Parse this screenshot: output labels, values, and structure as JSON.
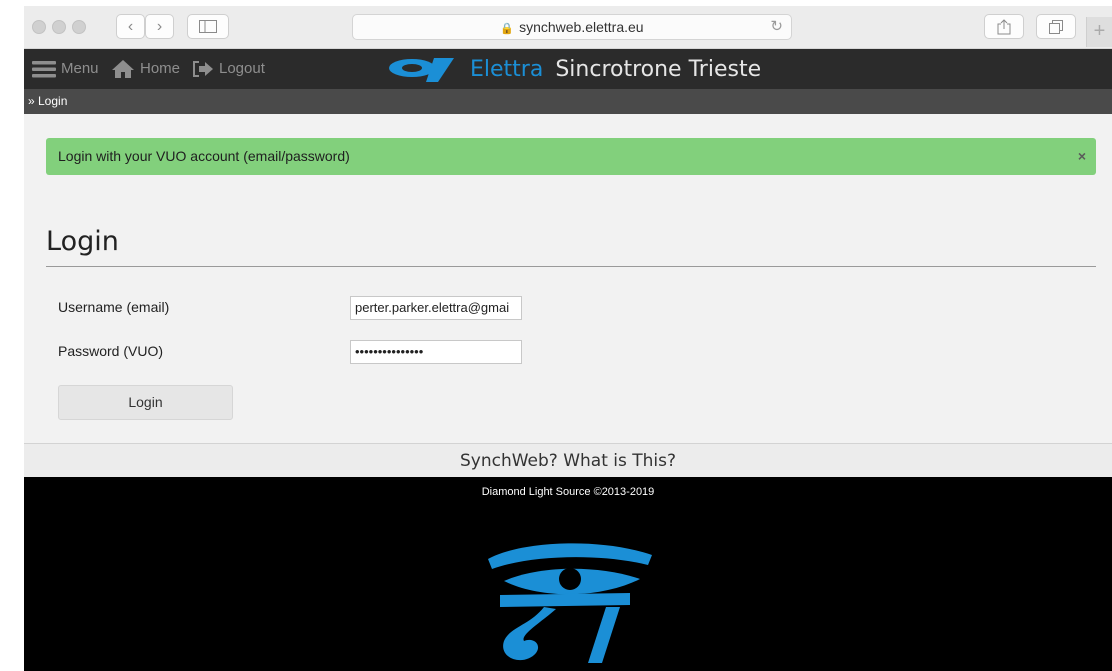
{
  "browser": {
    "url": "synchweb.elettra.eu",
    "back_glyph": "‹",
    "forward_glyph": "›",
    "icons": [
      "back-icon",
      "forward-icon",
      "sidebar-icon",
      "lock-icon",
      "reload-icon",
      "share-icon",
      "tabs-icon",
      "plus-icon"
    ]
  },
  "nav": {
    "menu_label": "Menu",
    "home_label": "Home",
    "logout_label": "Logout",
    "brand_name": "Elettra",
    "brand_sub": "Sincrotrone Trieste"
  },
  "breadcrumb": {
    "text": "» Login"
  },
  "alert": {
    "message": "Login with your VUO account (email/password)",
    "close_glyph": "×",
    "color": "#82d07c"
  },
  "login": {
    "title": "Login",
    "username_label": "Username (email)",
    "username_value": "perter.parker.elettra@gmai",
    "password_label": "Password (VUO)",
    "password_value": "•••••••••••••••",
    "submit_label": "Login"
  },
  "what_is_this": "SynchWeb? What is This?",
  "footer": {
    "copyright": "Diamond Light Source ©2013-2019"
  },
  "colors": {
    "brand_blue": "#1b8fd6",
    "navbar": "#2b2b2b",
    "footer": "#000000"
  }
}
